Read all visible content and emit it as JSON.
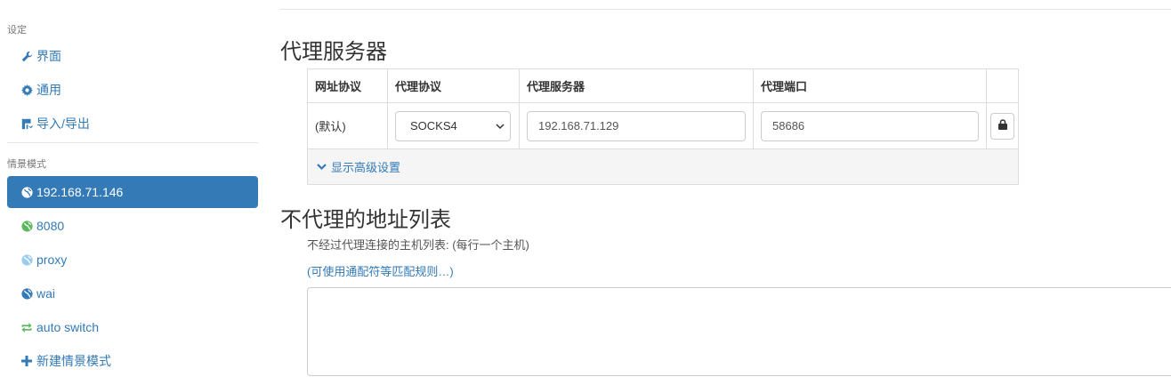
{
  "sidebar": {
    "settings_header": "设定",
    "settings_items": [
      {
        "label": "界面",
        "icon": "wrench-icon"
      },
      {
        "label": "通用",
        "icon": "gear-icon"
      },
      {
        "label": "导入/导出",
        "icon": "import-export-icon"
      }
    ],
    "profiles_header": "情景模式",
    "profiles": [
      {
        "label": "192.168.71.146",
        "icon": "globe-icon",
        "color": "#ffffff",
        "active": true
      },
      {
        "label": "8080",
        "icon": "globe-icon",
        "color": "#5cb85c"
      },
      {
        "label": "proxy",
        "icon": "globe-icon",
        "color": "#99ccee"
      },
      {
        "label": "wai",
        "icon": "globe-icon",
        "color": "#337ab7"
      },
      {
        "label": "auto switch",
        "icon": "refresh-icon",
        "color": "#5cb85c"
      },
      {
        "label": "新建情景模式",
        "icon": "plus-icon",
        "color": "#337ab7"
      }
    ]
  },
  "main": {
    "proxy_title": "代理服务器",
    "table": {
      "headers": [
        "网址协议",
        "代理协议",
        "代理服务器",
        "代理端口"
      ],
      "row": {
        "scheme": "(默认)",
        "protocol": "SOCKS4",
        "server": "192.168.71.129",
        "port": "58686"
      },
      "advanced_link": "显示高级设置"
    },
    "bypass_title": "不代理的地址列表",
    "bypass_desc": "不经过代理连接的主机列表: (每行一个主机)",
    "wildcard_link": "(可使用通配符等匹配规则…)"
  },
  "colors": {
    "accent": "#337ab7",
    "active_bg": "#337ab7"
  }
}
